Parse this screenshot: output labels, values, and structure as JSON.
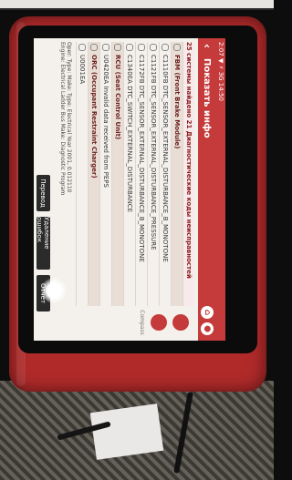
{
  "app": {
    "status_text": "2:07 ▼ ⚡ 3G 14:50",
    "title": "Показать инфо",
    "subtitle": "25 системы найдено 21 Диагностические коды неисправностей"
  },
  "dtc_list": [
    {
      "kind": "section",
      "text": "FBM (Front Brake Module)"
    },
    {
      "kind": "item",
      "text": "C1110FB DTC_SENSOR_EXTERNAL_DISTURBANCE_B_MONOTONE"
    },
    {
      "kind": "item",
      "text": "C1121FB DTC_SENSOR_EXTERNAL_DISTURBANCE_PRESSURE"
    },
    {
      "kind": "item",
      "text": "C1172FB DTC_SENSOR_EXTERNAL_DISTURBANCE_B_MONOTONE"
    },
    {
      "kind": "item",
      "text": "C1340EA DTC_SWITCH_EXTERNAL_DISTURBANCE"
    },
    {
      "kind": "section",
      "text": "RCU (Seat Control Unit)"
    },
    {
      "kind": "item",
      "text": "U0420EA Invalid data received from PEPS"
    },
    {
      "kind": "section",
      "text": "ORC (Occupant Restraint Charger)"
    },
    {
      "kind": "item",
      "text": "U0001EA"
    }
  ],
  "footer": {
    "line1": "Oper: Type: Make: Type: Electrical Year 2001, 0.012110",
    "line2": "Engine: Electrical Ladder Bus Make: Diagnostic Program"
  },
  "buttons": {
    "report": "Перевод",
    "save": "Удаление ошибок",
    "erase": "Отчет"
  },
  "right_label": "Compass"
}
